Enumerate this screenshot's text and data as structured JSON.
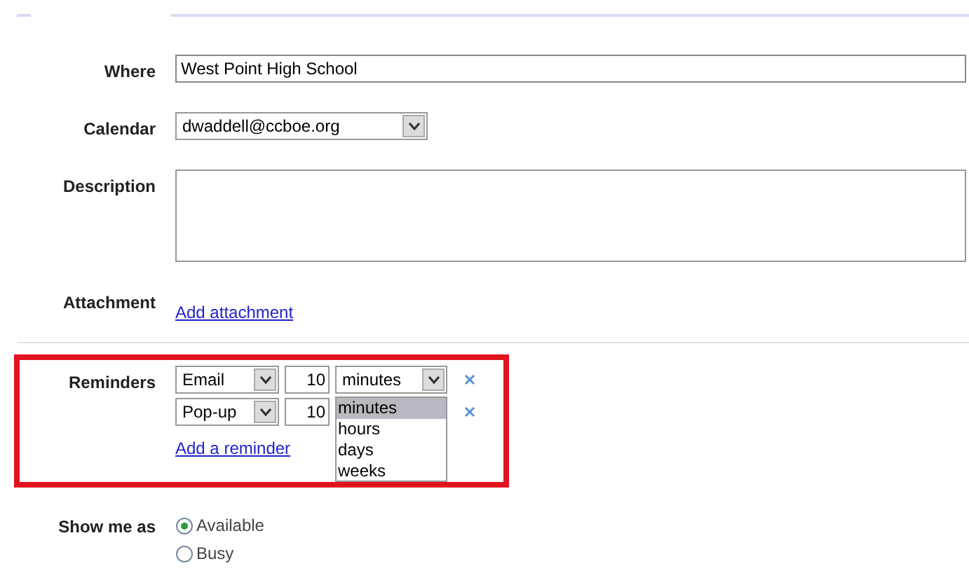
{
  "where": {
    "label": "Where",
    "value": "West Point High School"
  },
  "calendar": {
    "label": "Calendar",
    "value": "dwaddell@ccboe.org"
  },
  "description": {
    "label": "Description"
  },
  "attachment": {
    "label": "Attachment",
    "link": "Add attachment"
  },
  "reminders": {
    "label": "Reminders",
    "items": [
      {
        "method": "Email",
        "amount": "10",
        "unit": "minutes"
      },
      {
        "method": "Pop-up",
        "amount": "10"
      }
    ],
    "add_link": "Add a reminder",
    "unit_options": [
      {
        "label": "minutes",
        "selected": true
      },
      {
        "label": "hours",
        "selected": false
      },
      {
        "label": "days",
        "selected": false
      },
      {
        "label": "weeks",
        "selected": false
      }
    ]
  },
  "show_me_as": {
    "label": "Show me as",
    "options": [
      {
        "label": "Available",
        "selected": true
      },
      {
        "label": "Busy",
        "selected": false
      }
    ]
  }
}
